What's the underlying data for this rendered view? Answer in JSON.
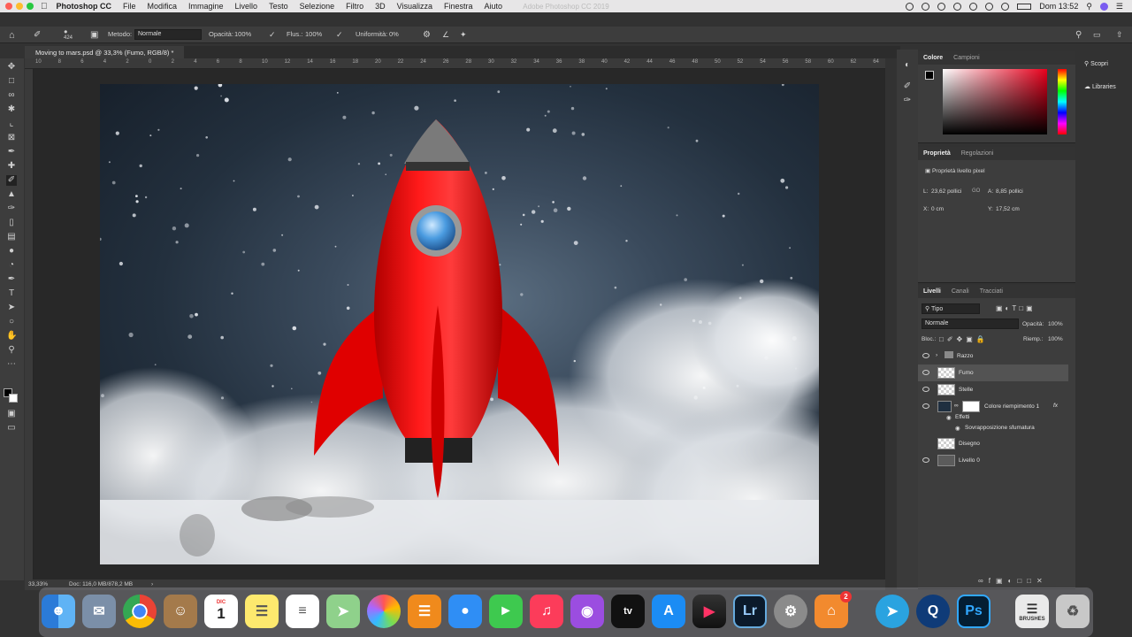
{
  "menubar": {
    "app": "Photoshop CC",
    "items": [
      "File",
      "Modifica",
      "Immagine",
      "Livello",
      "Testo",
      "Selezione",
      "Filtro",
      "3D",
      "Visualizza",
      "Finestra",
      "Aiuto"
    ],
    "center_title": "Adobe Photoshop CC 2019",
    "clock": "Dom 13:52"
  },
  "options": {
    "brush_size": "424",
    "metodo_label": "Metodo:",
    "metodo_value": "Normale",
    "opacita_label": "Opacità:",
    "opacita_value": "100%",
    "flusso_label": "Flus.:",
    "flusso_value": "100%",
    "uniformita_label": "Uniformità:",
    "uniformita_value": "0%"
  },
  "document": {
    "tab_title": "Moving to mars.psd @ 33,3% (Fumo, RGB/8) *",
    "ruler_ticks": [
      "10",
      "8",
      "6",
      "4",
      "2",
      "0",
      "2",
      "4",
      "6",
      "8",
      "10",
      "12",
      "14",
      "16",
      "18",
      "20",
      "22",
      "24",
      "26",
      "28",
      "30",
      "32",
      "34",
      "36",
      "38",
      "40",
      "42",
      "44",
      "46",
      "48",
      "50",
      "52",
      "54",
      "56",
      "58",
      "60",
      "62",
      "64"
    ]
  },
  "status": {
    "zoom": "33,33%",
    "doc": "Doc: 116,0 MB/878,2 MB"
  },
  "panels": {
    "color": {
      "tab1": "Colore",
      "tab2": "Campioni"
    },
    "right_tabs": {
      "scopri": "Scopri",
      "libraries": "Libraries"
    },
    "properties": {
      "tab1": "Proprietà",
      "tab2": "Regolazioni",
      "header": "Proprietà livello pixel",
      "w_label": "L:",
      "w_value": "23,62 pollici",
      "link": "GO",
      "h_label": "A:",
      "h_value": "8,85 pollici",
      "x_label": "X:",
      "x_value": "0 cm",
      "y_label": "Y:",
      "y_value": "17,52 cm"
    },
    "layers": {
      "tab1": "Livelli",
      "tab2": "Canali",
      "tab3": "Tracciati",
      "filter": "Tipo",
      "blend": "Normale",
      "opacity_label": "Opacità:",
      "opacity_value": "100%",
      "lock_label": "Bloc.:",
      "fill_label": "Riemp.:",
      "fill_value": "100%",
      "items": [
        {
          "name": "Razzo",
          "kind": "group"
        },
        {
          "name": "Fumo",
          "kind": "pixel"
        },
        {
          "name": "Stelle",
          "kind": "pixel"
        },
        {
          "name": "Colore riempimento 1",
          "kind": "fill"
        },
        {
          "name": "Effetti",
          "kind": "effect"
        },
        {
          "name": "Sovrapposizione sfumatura",
          "kind": "effect"
        },
        {
          "name": "Disegno",
          "kind": "pixel"
        },
        {
          "name": "Livello 0",
          "kind": "pixel"
        }
      ],
      "fx": "fx"
    }
  },
  "dock": {
    "calendar_month": "DIC",
    "calendar_day": "1",
    "home_badge": "2",
    "brushes_label": "BRUSHES"
  }
}
